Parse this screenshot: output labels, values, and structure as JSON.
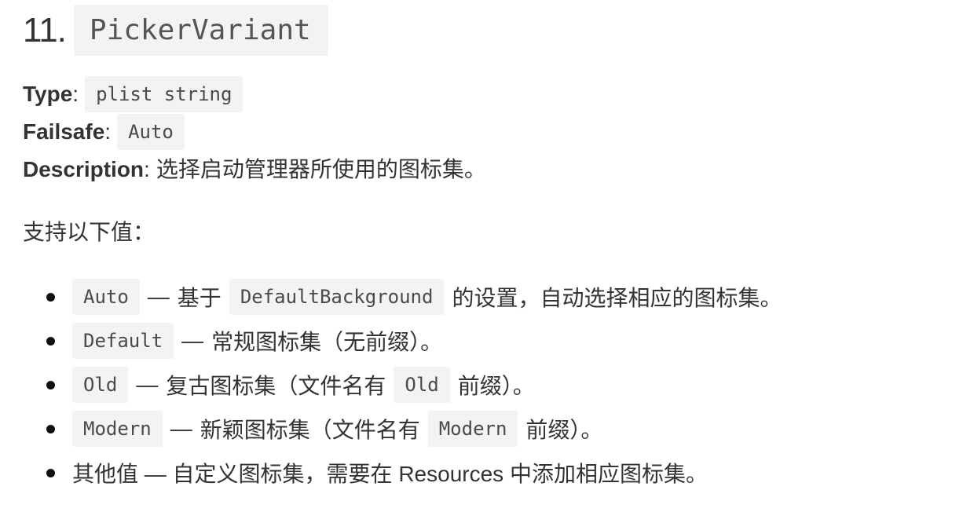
{
  "heading": {
    "number": "11.",
    "code": "PickerVariant"
  },
  "meta": {
    "type_key": "Type",
    "type_value": "plist string",
    "failsafe_key": "Failsafe",
    "failsafe_value": "Auto",
    "description_key": "Description",
    "description_value": "选择启动管理器所使用的图标集。",
    "separator": ":"
  },
  "intro": "支持以下值：",
  "items": [
    {
      "code": "Auto",
      "dash": "—",
      "text_before": "基于",
      "code2": "DefaultBackground",
      "text_after": "的设置，自动选择相应的图标集。"
    },
    {
      "code": "Default",
      "dash": "—",
      "text_before": "常规图标集（无前缀）。"
    },
    {
      "code": "Old",
      "dash": "—",
      "text_before": "复古图标集（文件名有",
      "code2": "Old",
      "text_after": "前缀）。"
    },
    {
      "code": "Modern",
      "dash": "—",
      "text_before": "新颖图标集（文件名有",
      "code2": "Modern",
      "text_after": "前缀）。"
    },
    {
      "text_plain": "其他值 — 自定义图标集，需要在 Resources 中添加相应图标集。"
    }
  ]
}
